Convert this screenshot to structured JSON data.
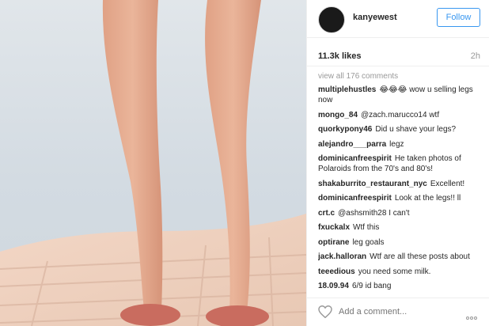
{
  "post": {
    "username": "kanyewest",
    "follow_label": "Follow",
    "likes": "11.3k likes",
    "time": "2h",
    "view_all": "view all 176 comments",
    "comments": [
      {
        "user": "multiplehustles",
        "text": "😂😂😂 wow u selling legs now"
      },
      {
        "user": "mongo_84",
        "text": "@zach.marucco14 wtf"
      },
      {
        "user": "quorkypony46",
        "text": "Did u shave your legs?"
      },
      {
        "user": "alejandro___parra",
        "text": "legz"
      },
      {
        "user": "dominicanfreespirit",
        "text": "He taken photos of Polaroids from the 70's and 80's!"
      },
      {
        "user": "shakaburrito_restaurant_nyc",
        "text": "Excellent!"
      },
      {
        "user": "dominicanfreespirit",
        "text": "Look at the legs!! ll"
      },
      {
        "user": "crt.c",
        "text": "@ashsmith28 I can't"
      },
      {
        "user": "fxuckalx",
        "text": "Wtf this"
      },
      {
        "user": "optirane",
        "text": "leg goals"
      },
      {
        "user": "jack.halloran",
        "text": "Wtf are all these posts about"
      },
      {
        "user": "teeedious",
        "text": "you need some milk."
      },
      {
        "user": "18.09.94",
        "text": "6/9 id bang"
      }
    ],
    "add_comment_placeholder": "Add a comment...",
    "icons": {
      "like": "heart-icon",
      "more": "more-options-icon"
    }
  }
}
